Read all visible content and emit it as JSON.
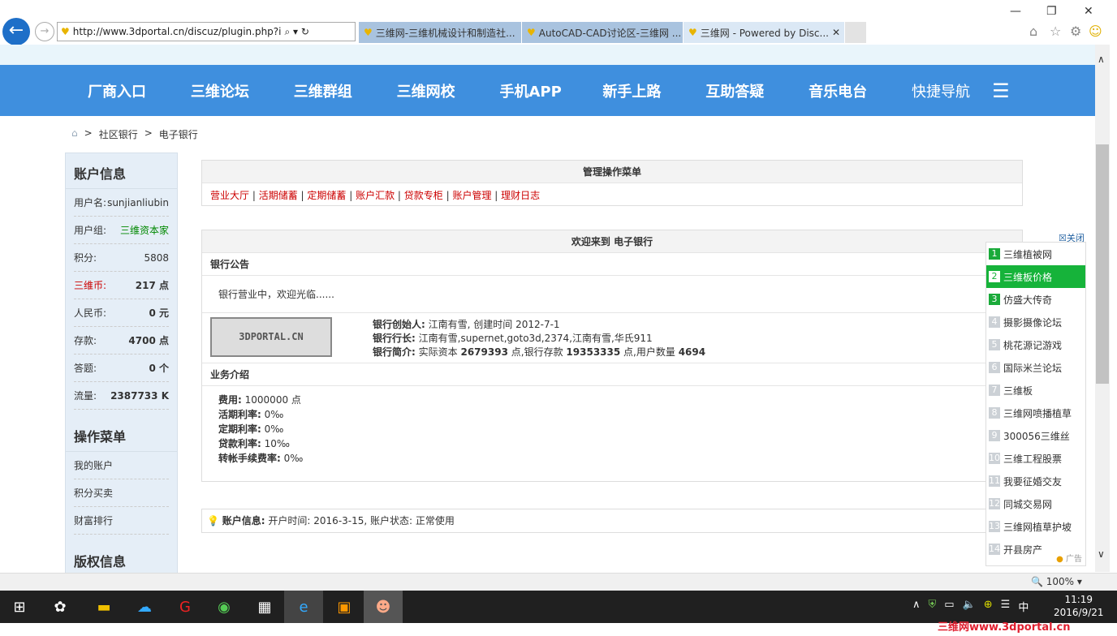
{
  "browser": {
    "url": "http://www.3dportal.cn/discuz/plugin.php?i",
    "tabs": [
      "三维网-三维机械设计和制造社...",
      "AutoCAD-CAD讨论区-三维网 ...",
      "三维网 - Powered by Disc..."
    ],
    "zoom": "100%"
  },
  "nav": [
    "厂商入口",
    "三维论坛",
    "三维群组",
    "三维网校",
    "手机APP",
    "新手上路",
    "互助答疑",
    "音乐电台",
    "快捷导航"
  ],
  "breadcrumb": [
    "社区银行",
    "电子银行"
  ],
  "sidebar": {
    "account_title": "账户信息",
    "rows": [
      {
        "k": "用户名:",
        "v": "sunjianliubin"
      },
      {
        "k": "用户组:",
        "v": "三维资本家"
      },
      {
        "k": "积分:",
        "v": "5808"
      },
      {
        "k": "三维币:",
        "v": "217 点"
      },
      {
        "k": "人民币:",
        "v": "0 元"
      },
      {
        "k": "存款:",
        "v": "4700 点"
      },
      {
        "k": "答题:",
        "v": "0 个"
      },
      {
        "k": "流量:",
        "v": "2387733 K"
      }
    ],
    "ops_title": "操作菜单",
    "ops": [
      "我的账户",
      "积分买卖",
      "财富排行"
    ],
    "copyright_title": "版权信息"
  },
  "menu": {
    "title": "管理操作菜单",
    "links": [
      "营业大厅",
      "活期储蓄",
      "定期储蓄",
      "账户汇款",
      "贷款专柜",
      "账户管理",
      "理财日志"
    ]
  },
  "welcome": {
    "title": "欢迎来到 电子银行",
    "notice_title": "银行公告",
    "notice": "银行营业中，欢迎光临......",
    "logo": "3DPORTAL.CN",
    "founder_label": "银行创始人:",
    "founder": "江南有雪, 创建时间 2012-7-1",
    "president_label": "银行行长:",
    "president": "江南有雪,supernet,goto3d,2374,江南有雪,华氏911",
    "intro_label": "银行简介:",
    "intro_a": "实际资本",
    "capital": "2679393",
    "intro_b": "点,银行存款",
    "deposit": "19353335",
    "intro_c": "点,用户数量",
    "users": "4694",
    "biz_title": "业务介绍",
    "biz": [
      {
        "k": "费用:",
        "v": "1000000 点"
      },
      {
        "k": "活期利率:",
        "v": "0‰"
      },
      {
        "k": "定期利率:",
        "v": "0‰"
      },
      {
        "k": "贷款利率:",
        "v": "10‰"
      },
      {
        "k": "转帐手续费率:",
        "v": "0‰"
      }
    ]
  },
  "account_info": {
    "label": "账户信息:",
    "text": "开户时间: 2016-3-15, 账户状态: 正常使用"
  },
  "ad": {
    "close": "关闭",
    "items": [
      "三维植被网",
      "三维板价格",
      "仿盛大传奇",
      "摄影摄像论坛",
      "桃花源记游戏",
      "国际米兰论坛",
      "三维板",
      "三维网喷播植草",
      "300056三维丝",
      "三维工程股票",
      "我要征婚交友",
      "同城交易网",
      "三维网植草护坡",
      "开县房产"
    ],
    "tag": "广告"
  },
  "taskbar": {
    "time": "11:19",
    "date": "2016/9/21",
    "ime": "中"
  },
  "watermark": "三维网www.3dportal.cn"
}
